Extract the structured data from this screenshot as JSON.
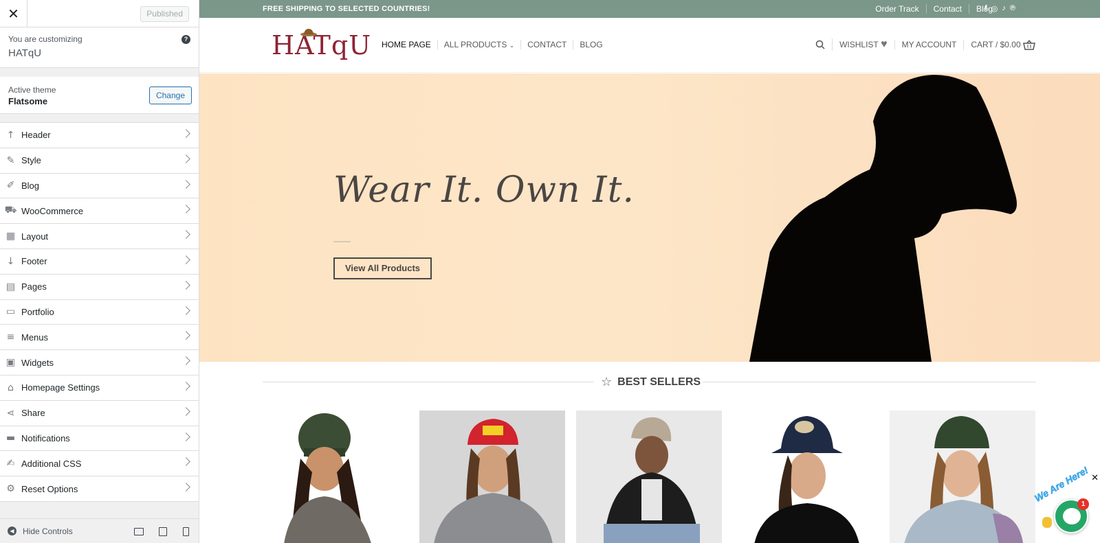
{
  "customizer": {
    "close_icon": "close-icon",
    "publish_label": "Published",
    "customizing_label": "You are customizing",
    "site_name": "HATqU",
    "help_icon": "help-icon",
    "active_theme_label": "Active theme",
    "theme_name": "Flatsome",
    "change_label": "Change",
    "panels": [
      {
        "label": "Header",
        "icon": "arrow-up-icon"
      },
      {
        "label": "Style",
        "icon": "brush-icon"
      },
      {
        "label": "Blog",
        "icon": "pencil-icon"
      },
      {
        "label": "WooCommerce",
        "icon": "cart-icon"
      },
      {
        "label": "Layout",
        "icon": "table-icon"
      },
      {
        "label": "Footer",
        "icon": "arrow-down-icon"
      },
      {
        "label": "Pages",
        "icon": "pages-icon"
      },
      {
        "label": "Portfolio",
        "icon": "folder-icon"
      },
      {
        "label": "Menus",
        "icon": "menu-icon"
      },
      {
        "label": "Widgets",
        "icon": "widgets-icon"
      },
      {
        "label": "Homepage Settings",
        "icon": "home-icon"
      },
      {
        "label": "Share",
        "icon": "share-icon"
      },
      {
        "label": "Notifications",
        "icon": "notification-icon"
      },
      {
        "label": "Additional CSS",
        "icon": "css-icon"
      },
      {
        "label": "Reset Options",
        "icon": "gear-icon"
      }
    ],
    "hide_controls_label": "Hide Controls"
  },
  "preview": {
    "topbar": {
      "shipping_text": "FREE SHIPPING TO SELECTED COUNTRIES!",
      "links": [
        "Order Track",
        "Contact",
        "Blog"
      ],
      "color": "#7b9789"
    },
    "logo_text": "HATqU",
    "nav": [
      "HOME PAGE",
      "ALL PRODUCTS",
      "CONTACT",
      "BLOG"
    ],
    "right_nav": {
      "wishlist": "WISHLIST",
      "account": "MY ACCOUNT",
      "cart": "CART / $0.00"
    },
    "hero": {
      "title": "Wear It. Own It.",
      "button": "View All Products"
    },
    "best_sellers_title": "BEST SELLERS",
    "chat": {
      "label": "We Are Here!",
      "badge": "1"
    }
  }
}
